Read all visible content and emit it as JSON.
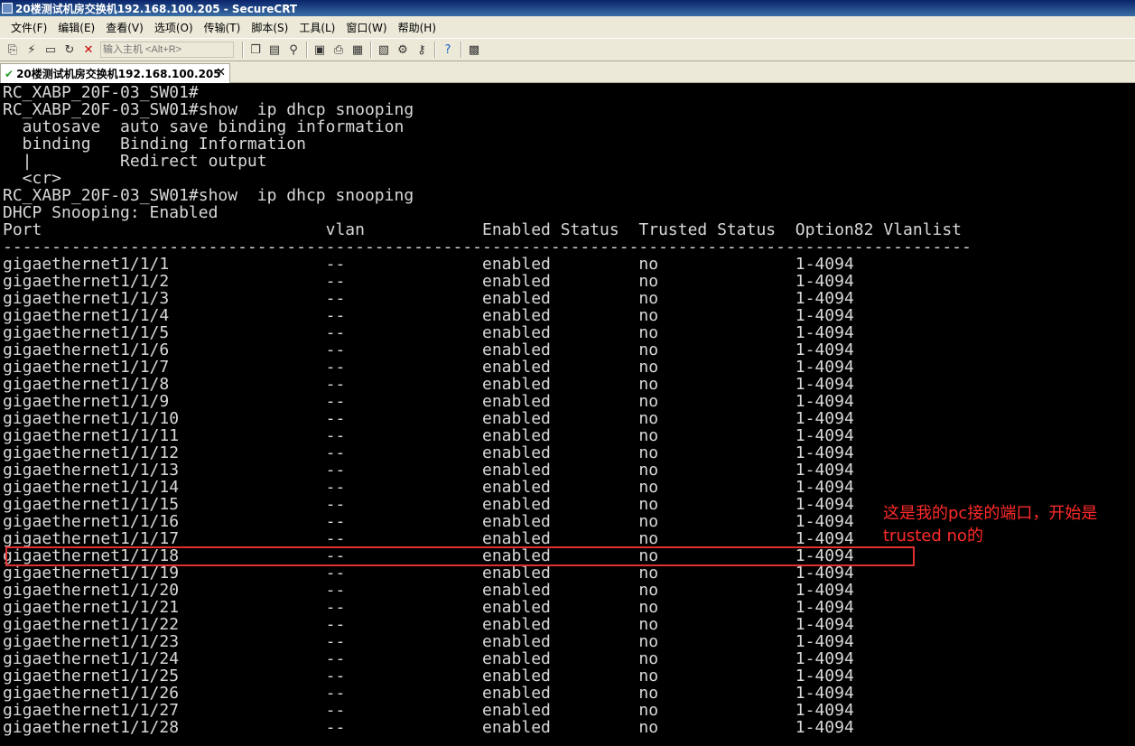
{
  "window": {
    "title": "20楼测试机房交换机192.168.100.205 - SecureCRT"
  },
  "menu": [
    "文件(F)",
    "编辑(E)",
    "查看(V)",
    "选项(O)",
    "传输(T)",
    "脚本(S)",
    "工具(L)",
    "窗口(W)",
    "帮助(H)"
  ],
  "toolbar": {
    "host_placeholder": "输入主机 <Alt+R>",
    "icons_left": [
      "connect-icon",
      "quick-connect-icon",
      "connect-tab-icon",
      "reconnect-icon",
      "disconnect-icon"
    ],
    "icons_right": [
      "copy-icon",
      "paste-icon",
      "find-icon",
      "print-setup-icon",
      "print-icon",
      "print-screen-icon",
      "session-options-icon",
      "global-options-icon",
      "keymap-icon",
      "help-icon",
      "sftp-icon"
    ]
  },
  "tab": {
    "label": "20楼测试机房交换机192.168.100.205"
  },
  "terminal": {
    "lines": [
      "RC_XABP_20F-03_SW01#",
      "RC_XABP_20F-03_SW01#show  ip dhcp snooping",
      "  autosave  auto save binding information",
      "  binding   Binding Information",
      "  |         Redirect output",
      "  <cr>",
      "RC_XABP_20F-03_SW01#show  ip dhcp snooping",
      "DHCP Snooping: Enabled",
      "Port                             vlan            Enabled Status  Trusted Status  Option82 Vlanlist",
      "---------------------------------------------------------------------------------------------------",
      "gigaethernet1/1/1                --              enabled         no              1-4094",
      "gigaethernet1/1/2                --              enabled         no              1-4094",
      "gigaethernet1/1/3                --              enabled         no              1-4094",
      "gigaethernet1/1/4                --              enabled         no              1-4094",
      "gigaethernet1/1/5                --              enabled         no              1-4094",
      "gigaethernet1/1/6                --              enabled         no              1-4094",
      "gigaethernet1/1/7                --              enabled         no              1-4094",
      "gigaethernet1/1/8                --              enabled         no              1-4094",
      "gigaethernet1/1/9                --              enabled         no              1-4094",
      "gigaethernet1/1/10               --              enabled         no              1-4094",
      "gigaethernet1/1/11               --              enabled         no              1-4094",
      "gigaethernet1/1/12               --              enabled         no              1-4094",
      "gigaethernet1/1/13               --              enabled         no              1-4094",
      "gigaethernet1/1/14               --              enabled         no              1-4094",
      "gigaethernet1/1/15               --              enabled         no              1-4094",
      "gigaethernet1/1/16               --              enabled         no              1-4094",
      "gigaethernet1/1/17               --              enabled         no              1-4094",
      "gigaethernet1/1/18               --              enabled         no              1-4094",
      "gigaethernet1/1/19               --              enabled         no              1-4094",
      "gigaethernet1/1/20               --              enabled         no              1-4094",
      "gigaethernet1/1/21               --              enabled         no              1-4094",
      "gigaethernet1/1/22               --              enabled         no              1-4094",
      "gigaethernet1/1/23               --              enabled         no              1-4094",
      "gigaethernet1/1/24               --              enabled         no              1-4094",
      "gigaethernet1/1/25               --              enabled         no              1-4094",
      "gigaethernet1/1/26               --              enabled         no              1-4094",
      "gigaethernet1/1/27               --              enabled         no              1-4094",
      "gigaethernet1/1/28               --              enabled         no              1-4094"
    ]
  },
  "annotation": {
    "text": "这是我的pc接的端口，开始是trusted no的",
    "color": "#ff2a2a"
  }
}
